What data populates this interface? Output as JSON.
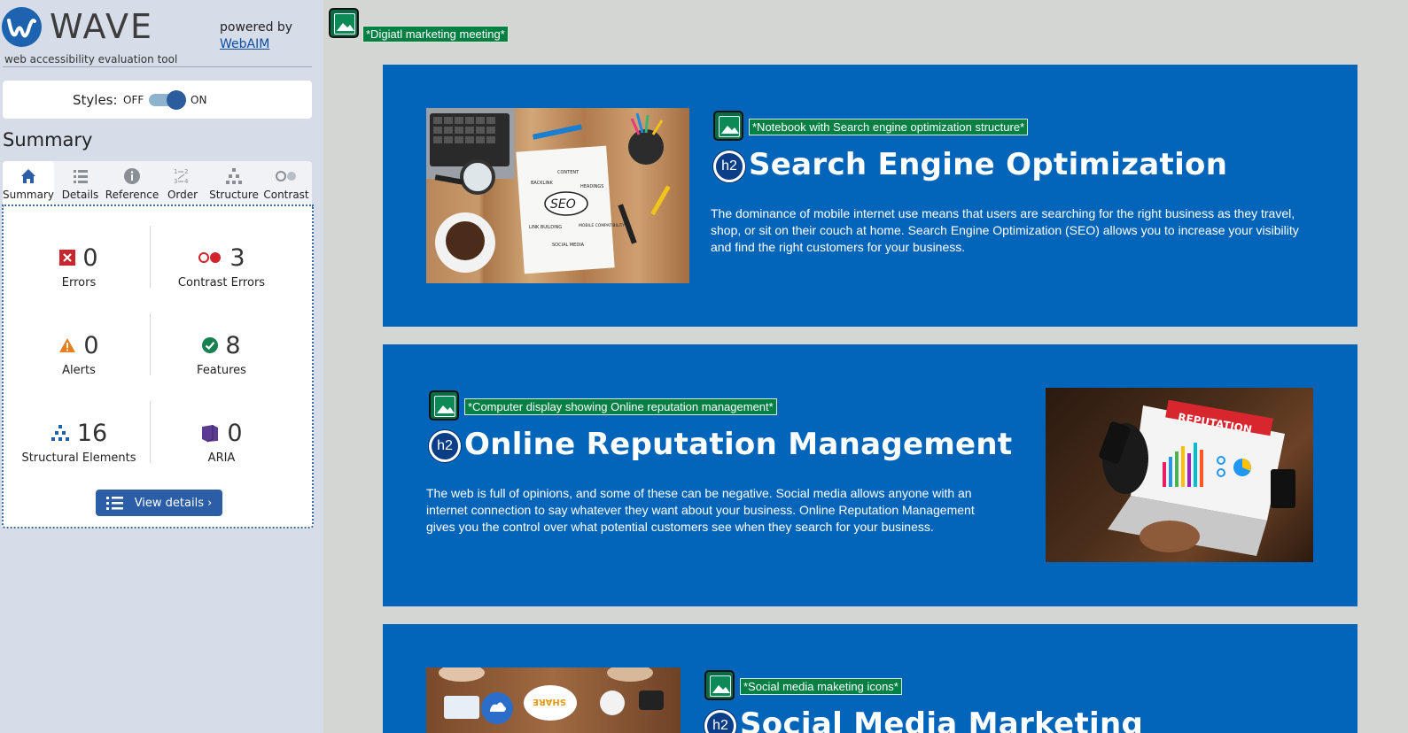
{
  "sidebar": {
    "brand": {
      "name": "WAVE",
      "tagline": "web accessibility evaluation tool"
    },
    "powered_by": {
      "text": "powered by",
      "link": "WebAIM"
    },
    "styles": {
      "label": "Styles:",
      "off": "OFF",
      "on": "ON",
      "enabled": true
    },
    "summary_title": "Summary",
    "tabs": [
      {
        "label": "Summary",
        "icon": "home-icon",
        "active": true
      },
      {
        "label": "Details",
        "icon": "list-icon"
      },
      {
        "label": "Reference",
        "icon": "info-icon"
      },
      {
        "label": "Order",
        "icon": "order-icon"
      },
      {
        "label": "Structure",
        "icon": "structure-icon"
      },
      {
        "label": "Contrast",
        "icon": "contrast-icon"
      }
    ],
    "stats": {
      "errors": {
        "count": "0",
        "label": "Errors",
        "color": "#c7262e"
      },
      "contrast_errors": {
        "count": "3",
        "label": "Contrast Errors",
        "color": "#d0232b"
      },
      "alerts": {
        "count": "0",
        "label": "Alerts",
        "color": "#e67e22"
      },
      "features": {
        "count": "8",
        "label": "Features",
        "color": "#19804f"
      },
      "structural": {
        "count": "16",
        "label": "Structural Elements",
        "color": "#1f5fa8"
      },
      "aria": {
        "count": "0",
        "label": "ARIA",
        "color": "#5b3c91"
      }
    },
    "view_details": "View details ›"
  },
  "main": {
    "top_alt": "*Digiatl marketing meeting*",
    "sections": [
      {
        "alt": "*Notebook with Search engine optimization structure*",
        "badge": "h2",
        "heading": "Search Engine Optimization",
        "body": "The dominance of mobile internet use means that users are searching for the right business as they travel, shop, or sit on their couch at home. Search Engine Optimization (SEO) allows you to increase your visibility and find the right customers for your business."
      },
      {
        "alt": "*Computer display showing Online reputation management*",
        "badge": "h2",
        "heading": "Online Reputation Management",
        "body": "The web is full of opinions, and some of these can be negative. Social media allows anyone with an internet connection to say whatever they want about your business. Online Reputation Management gives you the control over what potential customers see when they search for your business."
      },
      {
        "alt": "*Social media maketing icons*",
        "badge": "h2",
        "heading": "Social Media Marketing"
      }
    ],
    "image_text": {
      "seo": "SEO",
      "content": "CONTENT",
      "backlink": "BACKLINK",
      "headings": "HEADINGS",
      "link_building": "LINK BUILDING",
      "mobile": "MOBILE COMPATIBILITY",
      "social": "SOCIAL MEDIA",
      "reputation": "REPUTATION",
      "share": "SHARE"
    }
  },
  "colors": {
    "card_blue": "#0265b9",
    "sidebar_bg": "#d6dde8",
    "alt_green": "#058045"
  }
}
